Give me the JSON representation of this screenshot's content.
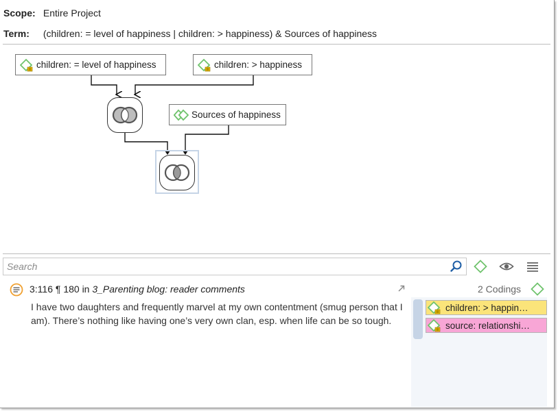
{
  "header": {
    "scope_label": "Scope:",
    "scope_value": "Entire Project",
    "term_label": "Term:",
    "term_value": "(children: = level of happiness | children: > happiness) & Sources of happiness"
  },
  "query_graph": {
    "nodes": [
      {
        "label": "children: = level of happiness",
        "icon": "code-icon"
      },
      {
        "label": "children: > happiness",
        "icon": "code-icon"
      },
      {
        "label": "Sources of happiness",
        "icon": "code-group-icon"
      }
    ],
    "operators": [
      {
        "name": "or-operator",
        "icon": "overlap-circles-icon"
      },
      {
        "name": "and-operator",
        "icon": "overlap-circles-icon",
        "selected": true
      }
    ]
  },
  "search": {
    "placeholder": "Search"
  },
  "toolbar": {
    "icons": [
      "search-icon",
      "code-filter-icon",
      "eye-icon",
      "menu-icon"
    ]
  },
  "quotation": {
    "id": "3:116",
    "pilcrow": "¶",
    "paragraph": "180",
    "in_word": "in",
    "document": "3_Parenting blog: reader comments",
    "text": "I have two daughters and frequently marvel at my own contentment (smug person that I am). There’s nothing like having one’s very own clan, esp. when life can be so tough."
  },
  "codings": {
    "count_label": "2 Codings",
    "items": [
      {
        "label": "children: > happin…",
        "color": "#fbe47a"
      },
      {
        "label": "source: relationshi…",
        "color": "#f8a6d6"
      }
    ]
  },
  "colors": {
    "code_green": "#6fc36c",
    "code_badge": "#f2c200",
    "selection": "#c5d4e6",
    "search_accent": "#1f5fa6"
  }
}
